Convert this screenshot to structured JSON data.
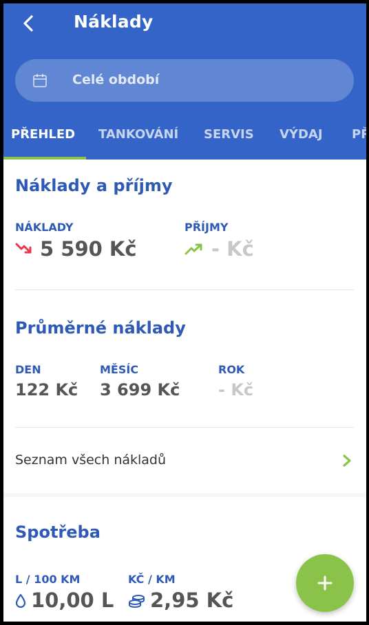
{
  "header": {
    "title": "Náklady"
  },
  "search": {
    "placeholder": "Celé období"
  },
  "tabs": [
    {
      "label": "PŘEHLED",
      "active": true
    },
    {
      "label": "TANKOVÁNÍ"
    },
    {
      "label": "SERVIS"
    },
    {
      "label": "VÝDAJ"
    },
    {
      "label": "PŘ"
    }
  ],
  "costs_income": {
    "title": "Náklady a příjmy",
    "costs_label": "NÁKLADY",
    "costs_value": "5 590 Kč",
    "income_label": "PŘÍJMY",
    "income_value": "- Kč"
  },
  "average": {
    "title": "Průměrné náklady",
    "day_label": "DEN",
    "day_value": "122 Kč",
    "month_label": "MĚSÍC",
    "month_value": "3 699 Kč",
    "year_label": "ROK",
    "year_value": "- Kč"
  },
  "all_costs_link": {
    "label": "Seznam všech nákladů"
  },
  "consumption": {
    "title": "Spotřeba",
    "per100_label": "L / 100 KM",
    "per100_value": "10,00 L",
    "perkm_label": "KČ / KM",
    "perkm_value": "2,95 Kč"
  },
  "icons": {
    "back": "arrow-left-icon",
    "calendar": "calendar-icon",
    "trend_down": "trend-down-icon",
    "trend_up": "trend-up-icon",
    "chevron": "chevron-right-icon",
    "drop": "drop-icon",
    "coins": "coins-icon",
    "add": "plus-icon"
  },
  "colors": {
    "primary": "#3564c8",
    "accent": "#8bc34a",
    "heading": "#2e5ab6",
    "negative": "#e53950",
    "value": "#555555"
  }
}
